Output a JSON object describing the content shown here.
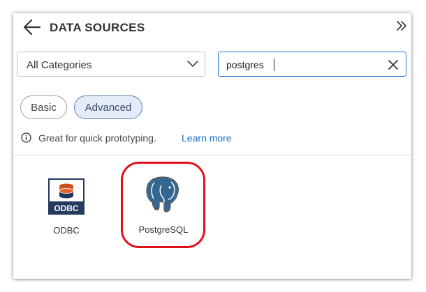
{
  "header": {
    "title": "DATA SOURCES",
    "back_icon": "arrow-left-icon",
    "collapse_icon": "double-chevron-right-icon"
  },
  "filters": {
    "category_select": {
      "value": "All Categories",
      "icon": "chevron-down-icon"
    },
    "search": {
      "value": "postgres",
      "placeholder": "",
      "clear_icon": "close-icon"
    }
  },
  "tabs": [
    {
      "label": "Basic",
      "selected": false
    },
    {
      "label": "Advanced",
      "selected": true
    }
  ],
  "info": {
    "icon": "info-icon",
    "text": "Great for quick prototyping.",
    "link_label": "Learn more"
  },
  "sources": [
    {
      "label": "ODBC",
      "icon": "odbc-icon",
      "badge": "ODBC"
    },
    {
      "label": "PostgreSQL",
      "icon": "postgresql-elephant-icon",
      "highlighted": true
    }
  ],
  "colors": {
    "accent_blue": "#1a6fc4",
    "selected_tab_bg": "#e3ecf8",
    "highlight_red": "#e0111b",
    "odbc_navy": "#243a5e",
    "odbc_orange": "#e8622c",
    "pg_blue": "#336791"
  }
}
